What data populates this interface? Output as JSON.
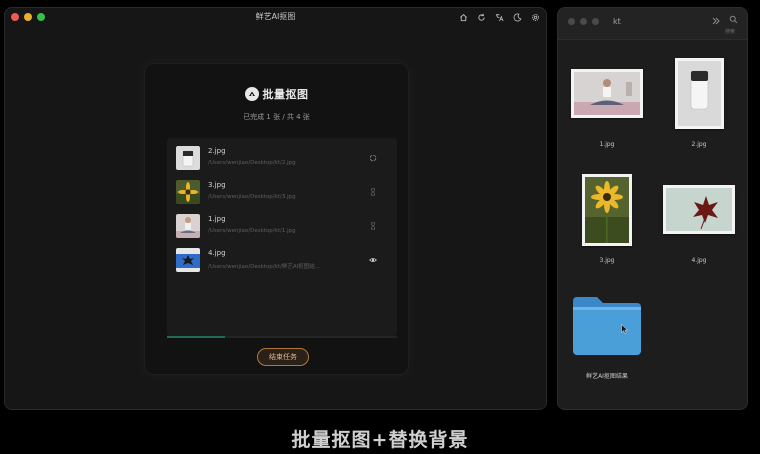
{
  "app": {
    "title": "鲜艺AI抠图",
    "toolbar_icons": [
      "home-icon",
      "refresh-icon",
      "translate-icon",
      "moon-icon",
      "gear-icon"
    ]
  },
  "dialog": {
    "brand_name": "批量抠图",
    "progress_text": "已完成 1 张 / 共 4 张",
    "progress_fraction": 0.25,
    "end_button_label": "结束任务",
    "files": [
      {
        "name": "2.jpg",
        "path": "/Users/wenjiao/Desktop/kt/2.jpg",
        "status_icon": "loading-icon"
      },
      {
        "name": "3.jpg",
        "path": "/Users/wenjiao/Desktop/kt/3.jpg",
        "status_icon": "hourglass-icon"
      },
      {
        "name": "1.jpg",
        "path": "/Users/wenjiao/Desktop/kt/1.jpg",
        "status_icon": "hourglass-icon"
      },
      {
        "name": "4.jpg",
        "path": "/Users/wenjiao/Desktop/kt/鲜艺AI抠图结...",
        "status_icon": "eye-icon"
      }
    ]
  },
  "finder": {
    "title": "kt",
    "search_label": "搜索",
    "items": [
      {
        "name": "1.jpg"
      },
      {
        "name": "2.jpg"
      },
      {
        "name": "3.jpg"
      },
      {
        "name": "4.jpg"
      }
    ],
    "folder_name": "鲜艺AI抠图结果"
  },
  "caption": "批量抠图+替换背景",
  "colors": {
    "accent_button_border": "#b1773a",
    "progress_fill": "#1f6b58",
    "folder": "#4a9fd8"
  }
}
